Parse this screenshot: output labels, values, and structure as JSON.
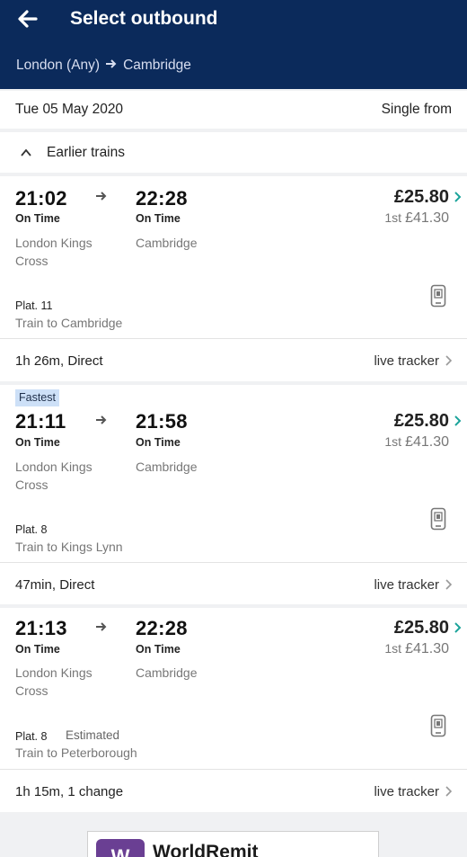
{
  "header": {
    "title": "Select outbound",
    "origin": "London (Any)",
    "destination": "Cambridge"
  },
  "datebar": {
    "date": "Tue 05 May 2020",
    "ticket_type": "Single from"
  },
  "earlier": {
    "label": "Earlier trains"
  },
  "journeys": [
    {
      "badge": "",
      "dep_time": "21:02",
      "dep_status": "On Time",
      "dep_station_1": "London Kings",
      "dep_station_2": "Cross",
      "arr_time": "22:28",
      "arr_status": "On Time",
      "arr_station": "Cambridge",
      "price": "£25.80",
      "first_label": "1st",
      "first_price": "£41.30",
      "platform": "Plat. 11",
      "platform_note": "",
      "service": "Train to Cambridge",
      "duration": "1h 26m, Direct",
      "tracker": "live tracker"
    },
    {
      "badge": "Fastest",
      "dep_time": "21:11",
      "dep_status": "On Time",
      "dep_station_1": "London Kings",
      "dep_station_2": "Cross",
      "arr_time": "21:58",
      "arr_status": "On Time",
      "arr_station": "Cambridge",
      "price": "£25.80",
      "first_label": "1st",
      "first_price": "£41.30",
      "platform": "Plat. 8",
      "platform_note": "",
      "service": "Train to Kings Lynn",
      "duration": "47min, Direct",
      "tracker": "live tracker"
    },
    {
      "badge": "",
      "dep_time": "21:13",
      "dep_status": "On Time",
      "dep_station_1": "London Kings",
      "dep_station_2": "Cross",
      "arr_time": "22:28",
      "arr_status": "On Time",
      "arr_station": "Cambridge",
      "price": "£25.80",
      "first_label": "1st",
      "first_price": "£41.30",
      "platform": "Plat. 8",
      "platform_note": "Estimated",
      "service": "Train to Peterborough",
      "duration": "1h 15m, 1 change",
      "tracker": "live tracker"
    }
  ],
  "ad": {
    "logo_letter": "W",
    "name": "WorldRemit"
  },
  "colors": {
    "header_bg": "#0b2a5b",
    "accent": "#1aa39a",
    "badge_bg": "#cde0f7"
  },
  "icons": [
    "back-arrow-icon",
    "right-arrow-icon",
    "chevron-up-icon",
    "chevron-right-icon",
    "mobile-ticket-icon"
  ]
}
